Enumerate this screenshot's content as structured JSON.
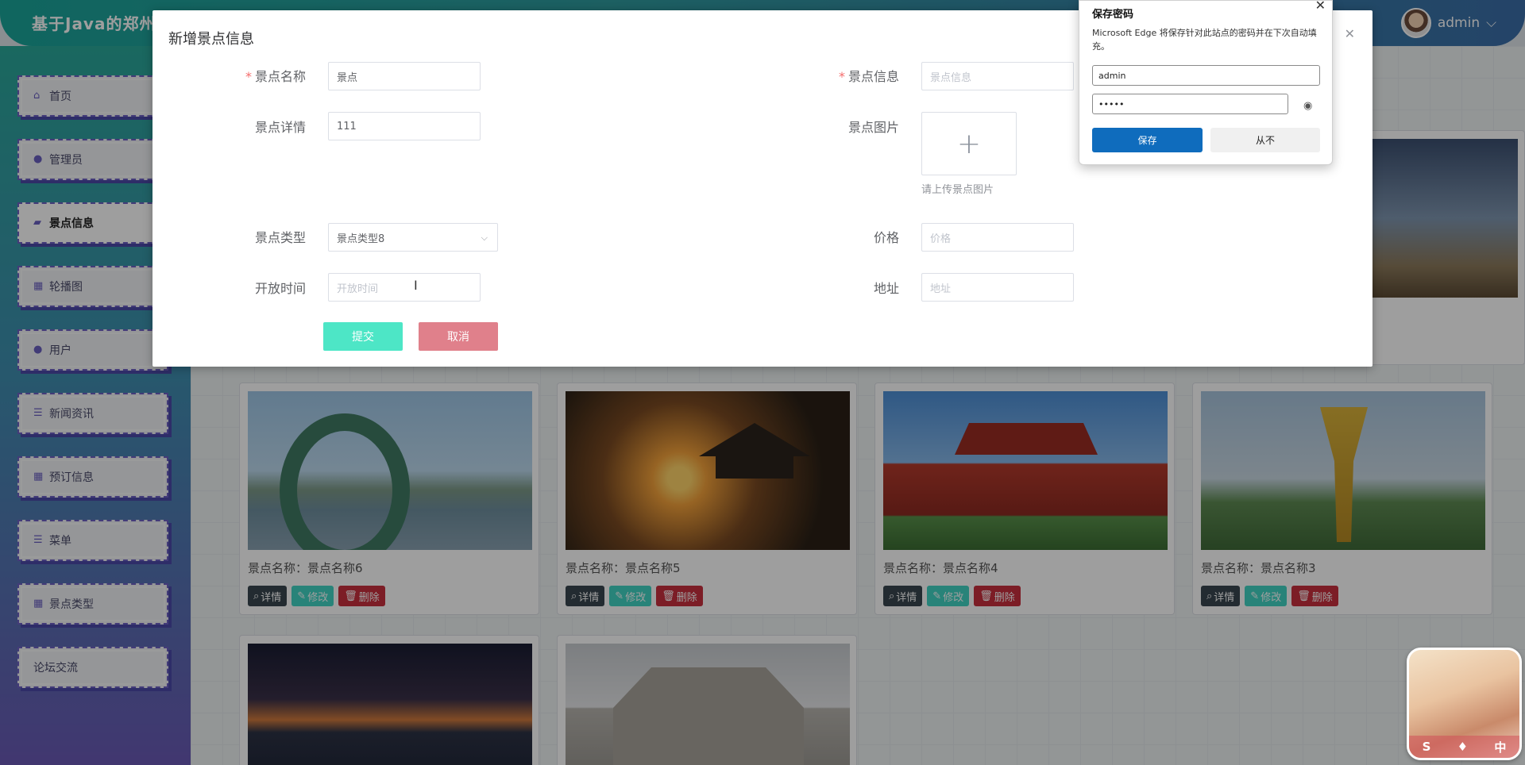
{
  "app": {
    "title": "基于Java的郑州",
    "user": "admin",
    "user_caret": "⌵"
  },
  "sidebar": {
    "items": [
      {
        "label": "首页",
        "icon": "home-icon",
        "glyph": "⌂"
      },
      {
        "label": "管理员",
        "icon": "person-icon",
        "glyph": "●"
      },
      {
        "label": "景点信息",
        "icon": "book-icon",
        "glyph": "▰",
        "active": true
      },
      {
        "label": "轮播图",
        "icon": "grid-icon",
        "glyph": "▦"
      },
      {
        "label": "用户",
        "icon": "person-icon",
        "glyph": "●"
      },
      {
        "label": "新闻资讯",
        "icon": "list-icon",
        "glyph": "☰"
      },
      {
        "label": "预订信息",
        "icon": "grid-icon",
        "glyph": "▦"
      },
      {
        "label": "菜单",
        "icon": "list-icon",
        "glyph": "☰"
      },
      {
        "label": "景点类型",
        "icon": "grid-icon",
        "glyph": "▦"
      },
      {
        "label": "论坛交流",
        "icon": "",
        "glyph": ""
      }
    ]
  },
  "cards": [
    {
      "title": "景点名称：景点名称6",
      "detail": "详情",
      "edit": "修改",
      "delete": "删除"
    },
    {
      "title": "景点名称：景点名称5",
      "detail": "详情",
      "edit": "修改",
      "delete": "删除"
    },
    {
      "title": "景点名称：景点名称4",
      "detail": "详情",
      "edit": "修改",
      "delete": "删除"
    },
    {
      "title": "景点名称：景点名称3",
      "detail": "详情",
      "edit": "修改",
      "delete": "删除"
    }
  ],
  "dialog": {
    "title": "新增景点信息",
    "close_glyph": "✕",
    "fields": {
      "name": {
        "label": "景点名称",
        "value": "景点",
        "required": true
      },
      "info": {
        "label": "景点信息",
        "placeholder": "景点信息",
        "required": true
      },
      "detail": {
        "label": "景点详情",
        "value": "111"
      },
      "image": {
        "label": "景点图片",
        "plus": "+",
        "tip": "请上传景点图片"
      },
      "type": {
        "label": "景点类型",
        "value": "景点类型8",
        "arrow": "⌵"
      },
      "price": {
        "label": "价格",
        "placeholder": "价格"
      },
      "open_time": {
        "label": "开放时间",
        "placeholder": "开放时间"
      },
      "address": {
        "label": "地址",
        "placeholder": "地址"
      }
    },
    "submit": "提交",
    "cancel": "取消",
    "cursor": "I"
  },
  "edge_popup": {
    "title": "保存密码",
    "close_glyph": "✕",
    "description": "Microsoft Edge 将保存针对此站点的密码并在下次自动填充。",
    "username": "admin",
    "password_mask": "•••••",
    "eye_glyph": "◉",
    "save": "保存",
    "never": "从不"
  },
  "ime": {
    "glyphs": [
      "S",
      "♦",
      "中"
    ]
  }
}
